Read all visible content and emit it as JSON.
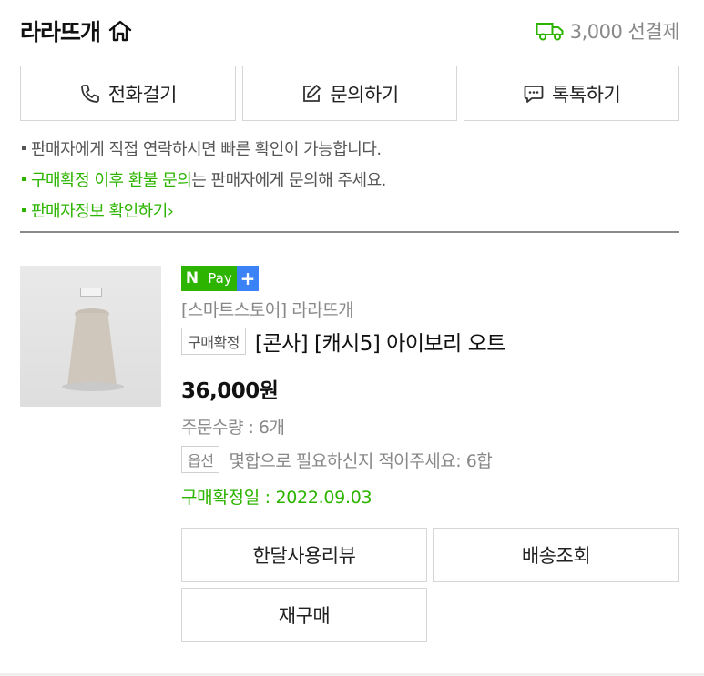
{
  "header": {
    "store_name": "라라뜨개",
    "store_icon": "home-icon",
    "shipping_icon": "truck-icon",
    "shipping_text": "3,000 선결제"
  },
  "contact_buttons": {
    "call": {
      "label": "전화걸기",
      "icon": "phone-icon"
    },
    "inquiry": {
      "label": "문의하기",
      "icon": "edit-icon"
    },
    "talk": {
      "label": "톡톡하기",
      "icon": "chat-icon"
    }
  },
  "notes": {
    "line1": "판매자에게 직접 연락하시면 빠른 확인이 가능합니다.",
    "line2_highlight": "구매확정 이후 환불 문의",
    "line2_rest": "는 판매자에게 문의해 주세요.",
    "line3": "판매자정보 확인하기"
  },
  "product": {
    "npay_n": "N",
    "npay_pay": "Pay",
    "npay_plus": "+",
    "store_label": "[스마트스토어] 라라뜨개",
    "status_badge": "구매확정",
    "title": "[콘사] [캐시5] 아이보리 오트",
    "price": "36,000원",
    "quantity": "주문수량 : 6개",
    "option_badge": "옵션",
    "option_text": "몇합으로 필요하신지 적어주세요: 6합",
    "confirm_date": "구매확정일 : 2022.09.03"
  },
  "actions": {
    "review": "한달사용리뷰",
    "shipping": "배송조회",
    "rebuy": "재구매"
  },
  "colors": {
    "accent_green": "#2db400",
    "npay_plus_blue": "#3b82f6"
  }
}
